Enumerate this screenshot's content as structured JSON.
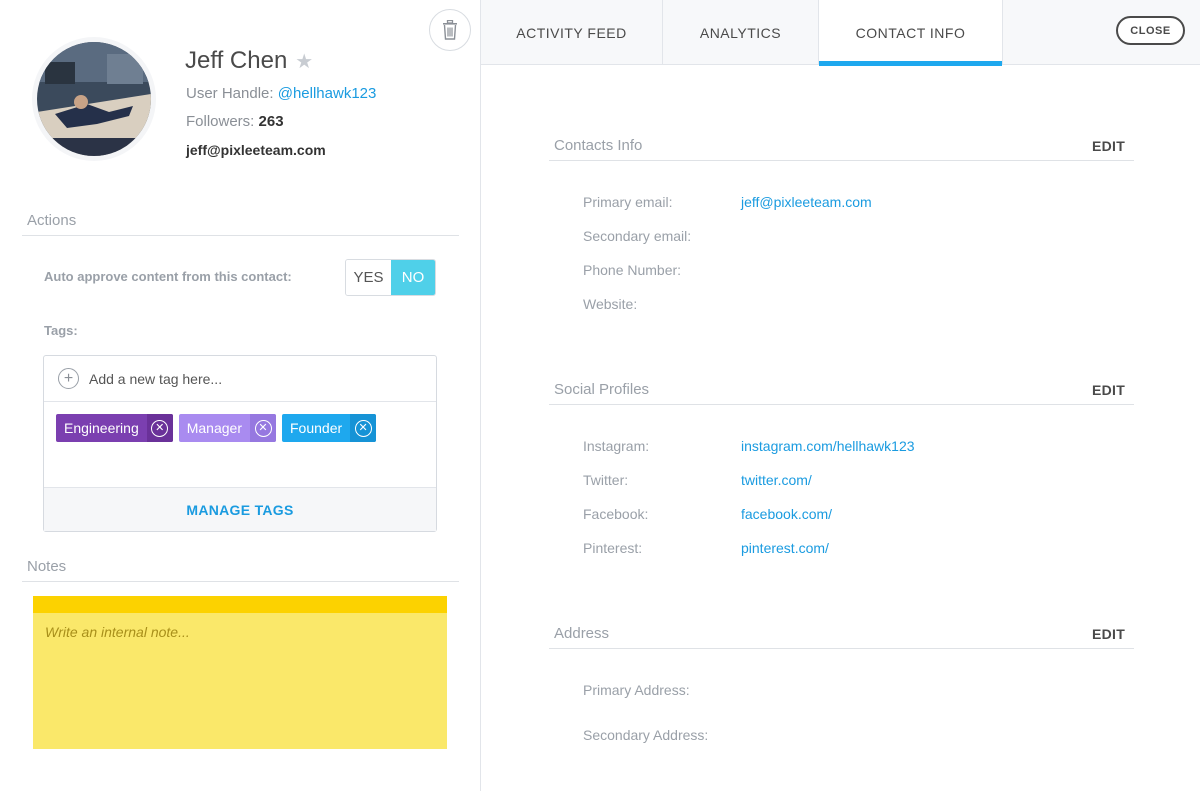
{
  "profile": {
    "name": "Jeff Chen",
    "handle_label": "User Handle:",
    "handle": "@hellhawk123",
    "followers_label": "Followers:",
    "followers": "263",
    "email": "jeff@pixleeteam.com"
  },
  "actions": {
    "title": "Actions",
    "auto_approve_label": "Auto approve content from this contact:",
    "yes_label": "YES",
    "no_label": "NO",
    "selected": "NO"
  },
  "tags": {
    "label": "Tags:",
    "add_placeholder": "Add a new tag here...",
    "items": [
      {
        "label": "Engineering",
        "color": "#7b3fb0",
        "x_color": "#6a3199"
      },
      {
        "label": "Manager",
        "color": "#a98bf0",
        "x_color": "#9678e0"
      },
      {
        "label": "Founder",
        "color": "#1ea8ee",
        "x_color": "#1693d6"
      }
    ],
    "manage_label": "MANAGE TAGS"
  },
  "notes": {
    "title": "Notes",
    "placeholder": "Write an internal note..."
  },
  "tabs": [
    {
      "label": "ACTIVITY FEED",
      "active": false
    },
    {
      "label": "ANALYTICS",
      "active": false
    },
    {
      "label": "CONTACT INFO",
      "active": true
    }
  ],
  "close_label": "CLOSE",
  "contacts_info": {
    "title": "Contacts Info",
    "edit_label": "EDIT",
    "fields": [
      {
        "label": "Primary email:",
        "value": "jeff@pixleeteam.com"
      },
      {
        "label": "Secondary email:",
        "value": ""
      },
      {
        "label": "Phone Number:",
        "value": ""
      },
      {
        "label": "Website:",
        "value": ""
      }
    ]
  },
  "social_profiles": {
    "title": "Social Profiles",
    "edit_label": "EDIT",
    "fields": [
      {
        "label": "Instagram:",
        "value": "instagram.com/hellhawk123"
      },
      {
        "label": "Twitter:",
        "value": "twitter.com/"
      },
      {
        "label": "Facebook:",
        "value": "facebook.com/"
      },
      {
        "label": "Pinterest:",
        "value": "pinterest.com/"
      }
    ]
  },
  "address": {
    "title": "Address",
    "edit_label": "EDIT",
    "fields": [
      {
        "label": "Primary Address:",
        "value": ""
      },
      {
        "label": "Secondary Address:",
        "value": ""
      }
    ]
  },
  "colors": {
    "accent": "#1a9be0",
    "toggle_selected": "#4fd0e9",
    "note_bg": "#fae86a",
    "note_header": "#fcd200"
  }
}
